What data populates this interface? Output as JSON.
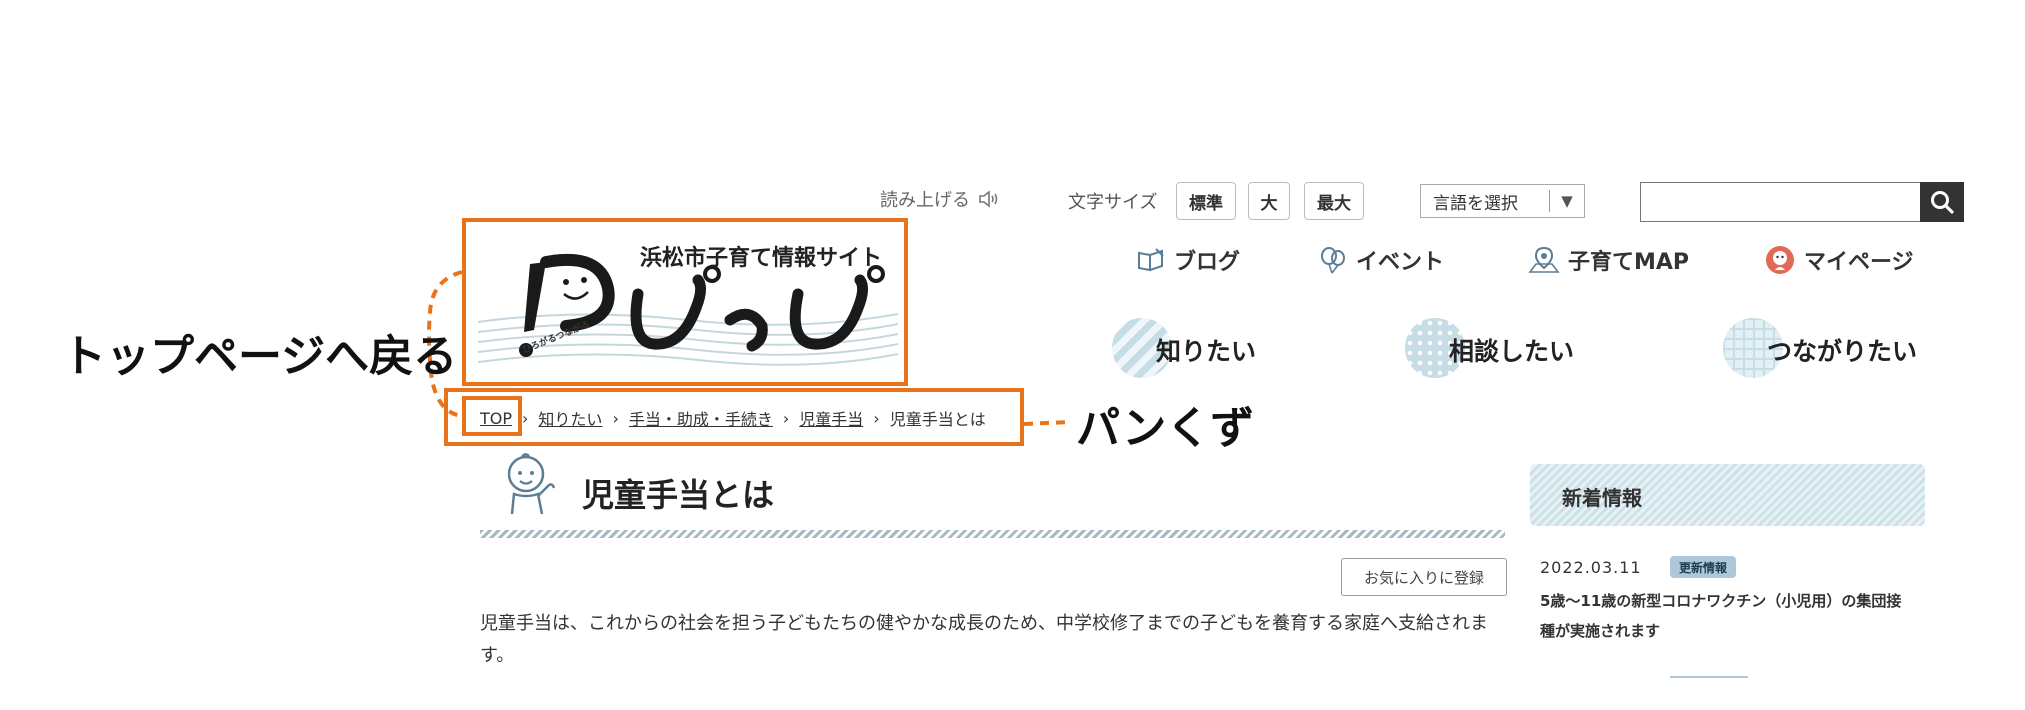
{
  "header": {
    "read_aloud": "読み上げる",
    "font_size_label": "文字サイズ",
    "font_sizes": [
      "標準",
      "大",
      "最大"
    ],
    "language_select": "言語を選択",
    "search_placeholder": ""
  },
  "logo": {
    "subtitle": "浜松市子育て情報サイト",
    "name": "ぴっぴ",
    "tagline": "ひろがるつながる"
  },
  "sub_nav": [
    "ブログ",
    "イベント",
    "子育てMAP",
    "マイページ"
  ],
  "main_nav": [
    "知りたい",
    "相談したい",
    "つながりたい"
  ],
  "breadcrumb": {
    "items": [
      "TOP",
      "知りたい",
      "手当・助成・手続き",
      "児童手当"
    ],
    "current": "児童手当とは",
    "separator": "›"
  },
  "annotations": {
    "top_page": "トップページへ戻る",
    "breadcrumb": "パンくず"
  },
  "page": {
    "title": "児童手当とは",
    "favorite_button": "お気に入りに登録",
    "body": "児童手当は、これからの社会を担う子どもたちの健やかな成長のため、中学校修了までの子どもを養育する家庭へ支給されます。"
  },
  "sidebar": {
    "title": "新着情報",
    "news": [
      {
        "date": "2022.03.11",
        "tag": "更新情報",
        "text": "5歳～11歳の新型コロナワクチン（小児用）の集団接種が実施されます"
      }
    ]
  },
  "colors": {
    "annotation": "#e8731b",
    "nav_pattern": "#c6dde6",
    "search_button": "#333333",
    "tag_bg": "#aec7d9"
  }
}
